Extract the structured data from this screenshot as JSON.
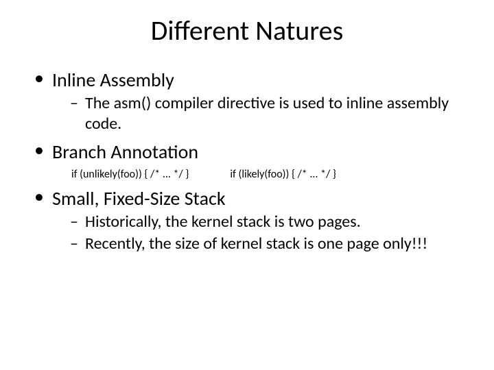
{
  "title": "Different Natures",
  "bullets": {
    "b1": {
      "heading": "Inline Assembly",
      "sub1": "The asm() compiler directive is used to inline assembly code."
    },
    "b2": {
      "heading": "Branch Annotation",
      "code1": "if (unlikely(foo)) { /* ... */ }",
      "code2": "if (likely(foo)) { /* ... */ }"
    },
    "b3": {
      "heading": "Small, Fixed-Size Stack",
      "sub1": "Historically, the kernel stack is two pages.",
      "sub2": "Recently, the size of kernel stack is one page only!!!"
    }
  }
}
